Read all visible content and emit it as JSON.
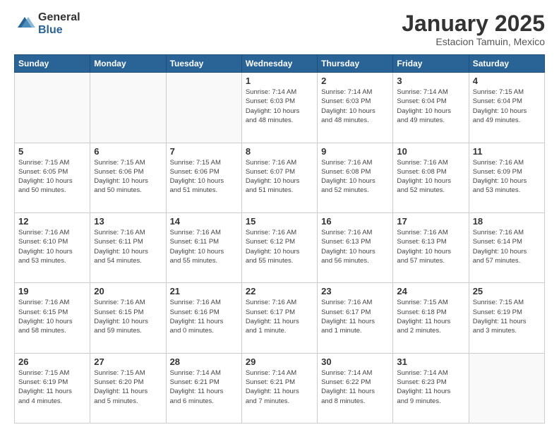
{
  "logo": {
    "general": "General",
    "blue": "Blue"
  },
  "header": {
    "month": "January 2025",
    "location": "Estacion Tamuin, Mexico"
  },
  "days_of_week": [
    "Sunday",
    "Monday",
    "Tuesday",
    "Wednesday",
    "Thursday",
    "Friday",
    "Saturday"
  ],
  "weeks": [
    [
      {
        "day": "",
        "info": ""
      },
      {
        "day": "",
        "info": ""
      },
      {
        "day": "",
        "info": ""
      },
      {
        "day": "1",
        "info": "Sunrise: 7:14 AM\nSunset: 6:03 PM\nDaylight: 10 hours\nand 48 minutes."
      },
      {
        "day": "2",
        "info": "Sunrise: 7:14 AM\nSunset: 6:03 PM\nDaylight: 10 hours\nand 48 minutes."
      },
      {
        "day": "3",
        "info": "Sunrise: 7:14 AM\nSunset: 6:04 PM\nDaylight: 10 hours\nand 49 minutes."
      },
      {
        "day": "4",
        "info": "Sunrise: 7:15 AM\nSunset: 6:04 PM\nDaylight: 10 hours\nand 49 minutes."
      }
    ],
    [
      {
        "day": "5",
        "info": "Sunrise: 7:15 AM\nSunset: 6:05 PM\nDaylight: 10 hours\nand 50 minutes."
      },
      {
        "day": "6",
        "info": "Sunrise: 7:15 AM\nSunset: 6:06 PM\nDaylight: 10 hours\nand 50 minutes."
      },
      {
        "day": "7",
        "info": "Sunrise: 7:15 AM\nSunset: 6:06 PM\nDaylight: 10 hours\nand 51 minutes."
      },
      {
        "day": "8",
        "info": "Sunrise: 7:16 AM\nSunset: 6:07 PM\nDaylight: 10 hours\nand 51 minutes."
      },
      {
        "day": "9",
        "info": "Sunrise: 7:16 AM\nSunset: 6:08 PM\nDaylight: 10 hours\nand 52 minutes."
      },
      {
        "day": "10",
        "info": "Sunrise: 7:16 AM\nSunset: 6:08 PM\nDaylight: 10 hours\nand 52 minutes."
      },
      {
        "day": "11",
        "info": "Sunrise: 7:16 AM\nSunset: 6:09 PM\nDaylight: 10 hours\nand 53 minutes."
      }
    ],
    [
      {
        "day": "12",
        "info": "Sunrise: 7:16 AM\nSunset: 6:10 PM\nDaylight: 10 hours\nand 53 minutes."
      },
      {
        "day": "13",
        "info": "Sunrise: 7:16 AM\nSunset: 6:11 PM\nDaylight: 10 hours\nand 54 minutes."
      },
      {
        "day": "14",
        "info": "Sunrise: 7:16 AM\nSunset: 6:11 PM\nDaylight: 10 hours\nand 55 minutes."
      },
      {
        "day": "15",
        "info": "Sunrise: 7:16 AM\nSunset: 6:12 PM\nDaylight: 10 hours\nand 55 minutes."
      },
      {
        "day": "16",
        "info": "Sunrise: 7:16 AM\nSunset: 6:13 PM\nDaylight: 10 hours\nand 56 minutes."
      },
      {
        "day": "17",
        "info": "Sunrise: 7:16 AM\nSunset: 6:13 PM\nDaylight: 10 hours\nand 57 minutes."
      },
      {
        "day": "18",
        "info": "Sunrise: 7:16 AM\nSunset: 6:14 PM\nDaylight: 10 hours\nand 57 minutes."
      }
    ],
    [
      {
        "day": "19",
        "info": "Sunrise: 7:16 AM\nSunset: 6:15 PM\nDaylight: 10 hours\nand 58 minutes."
      },
      {
        "day": "20",
        "info": "Sunrise: 7:16 AM\nSunset: 6:15 PM\nDaylight: 10 hours\nand 59 minutes."
      },
      {
        "day": "21",
        "info": "Sunrise: 7:16 AM\nSunset: 6:16 PM\nDaylight: 11 hours\nand 0 minutes."
      },
      {
        "day": "22",
        "info": "Sunrise: 7:16 AM\nSunset: 6:17 PM\nDaylight: 11 hours\nand 1 minute."
      },
      {
        "day": "23",
        "info": "Sunrise: 7:16 AM\nSunset: 6:17 PM\nDaylight: 11 hours\nand 1 minute."
      },
      {
        "day": "24",
        "info": "Sunrise: 7:15 AM\nSunset: 6:18 PM\nDaylight: 11 hours\nand 2 minutes."
      },
      {
        "day": "25",
        "info": "Sunrise: 7:15 AM\nSunset: 6:19 PM\nDaylight: 11 hours\nand 3 minutes."
      }
    ],
    [
      {
        "day": "26",
        "info": "Sunrise: 7:15 AM\nSunset: 6:19 PM\nDaylight: 11 hours\nand 4 minutes."
      },
      {
        "day": "27",
        "info": "Sunrise: 7:15 AM\nSunset: 6:20 PM\nDaylight: 11 hours\nand 5 minutes."
      },
      {
        "day": "28",
        "info": "Sunrise: 7:14 AM\nSunset: 6:21 PM\nDaylight: 11 hours\nand 6 minutes."
      },
      {
        "day": "29",
        "info": "Sunrise: 7:14 AM\nSunset: 6:21 PM\nDaylight: 11 hours\nand 7 minutes."
      },
      {
        "day": "30",
        "info": "Sunrise: 7:14 AM\nSunset: 6:22 PM\nDaylight: 11 hours\nand 8 minutes."
      },
      {
        "day": "31",
        "info": "Sunrise: 7:14 AM\nSunset: 6:23 PM\nDaylight: 11 hours\nand 9 minutes."
      },
      {
        "day": "",
        "info": ""
      }
    ]
  ]
}
